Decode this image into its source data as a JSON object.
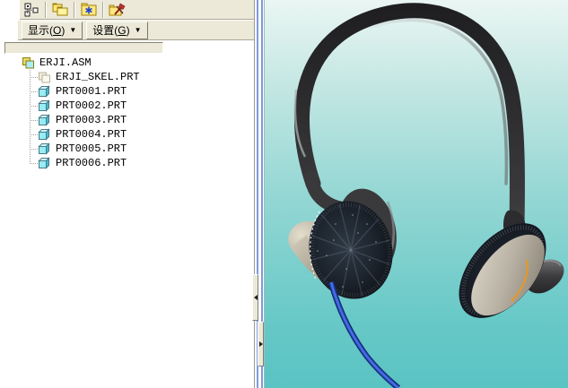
{
  "app": {
    "name": "Pro/ENGINEER model tree panel with 3D headphone assembly view"
  },
  "model_tree_panel": {
    "toolbar_icons": [
      {
        "name": "model-tree-view-icon"
      },
      {
        "name": "layer-folders-icon"
      },
      {
        "name": "folder-asterisk-icon"
      },
      {
        "name": "folder-tools-icon"
      }
    ],
    "buttons": {
      "show": {
        "pre": "显示(",
        "mnemonic": "O",
        "post": ")",
        "arrow": "▼"
      },
      "settings": {
        "pre": "设置(",
        "mnemonic": "G",
        "post": ")",
        "arrow": "▼"
      }
    },
    "tree": {
      "root": {
        "label": "ERJI.ASM",
        "icon": "assembly-icon"
      },
      "children": [
        {
          "label": "ERJI_SKEL.PRT",
          "icon": "skeleton-part-icon"
        },
        {
          "label": "PRT0001.PRT",
          "icon": "part-icon"
        },
        {
          "label": "PRT0002.PRT",
          "icon": "part-icon"
        },
        {
          "label": "PRT0003.PRT",
          "icon": "part-icon"
        },
        {
          "label": "PRT0004.PRT",
          "icon": "part-icon"
        },
        {
          "label": "PRT0005.PRT",
          "icon": "part-icon"
        },
        {
          "label": "PRT0006.PRT",
          "icon": "part-icon"
        }
      ]
    }
  },
  "splitter": {
    "icons": [
      {
        "name": "collapse-left-arrow-icon"
      },
      {
        "name": "collapse-right-arrow-icon"
      }
    ]
  },
  "viewport": {
    "content": "headphone assembly 3D shaded model",
    "colors": {
      "background_top": "#eaf6f3",
      "background_bottom": "#5ac3c3",
      "headband": "#2f2f31",
      "ear_pad_foam": "#161b22",
      "cup_face": "#cdc7b8",
      "cable": "#2a52c8",
      "edge_accent": "#e89822"
    }
  }
}
